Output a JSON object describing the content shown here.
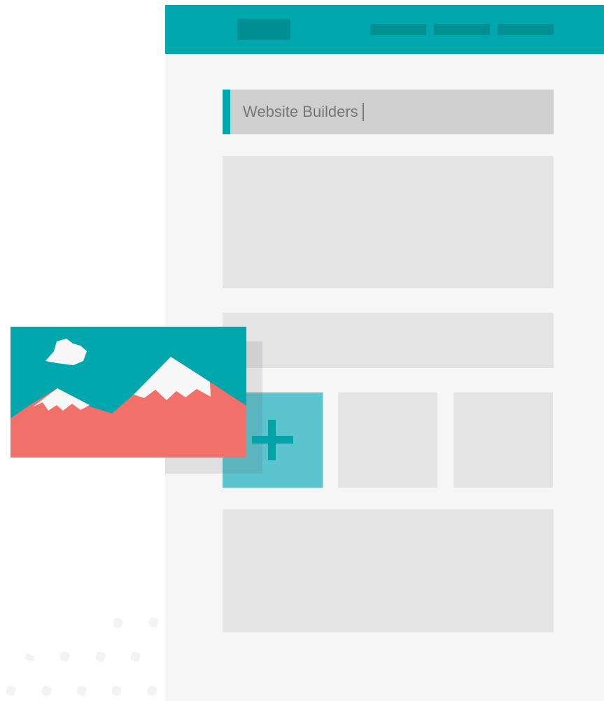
{
  "editor": {
    "title_input_value": "Website Builders"
  },
  "colors": {
    "accent": "#00a8ad",
    "accent_dark": "#008f93",
    "add_tile": "#5bc4cf",
    "mountain": "#f2706a",
    "snow": "#f7f7f7"
  },
  "icons": {
    "add": "plus-icon",
    "image": "landscape-image-icon",
    "cloud": "cloud-icon"
  }
}
